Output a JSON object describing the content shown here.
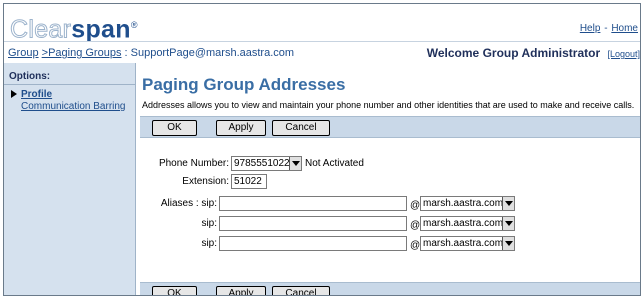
{
  "brand": {
    "part1": "Clear",
    "part2": "span",
    "tm": "®"
  },
  "toplinks": {
    "help": "Help",
    "sep": "-",
    "home": "Home"
  },
  "breadcrumb": {
    "group": "Group",
    "paging_groups": ">Paging Groups",
    "current": ": SupportPage@marsh.aastra.com"
  },
  "welcome": {
    "text": "Welcome Group Administrator",
    "logout": "[Logout]"
  },
  "sidebar": {
    "options_label": "Options:",
    "items": [
      {
        "label": "Profile",
        "active": true
      },
      {
        "label": "Communication Barring",
        "active": false
      }
    ]
  },
  "page": {
    "title": "Paging Group Addresses",
    "description": "Addresses allows you to view and maintain your phone number and other identities that are used to make and receive calls."
  },
  "buttons": {
    "ok": "OK",
    "apply": "Apply",
    "cancel": "Cancel"
  },
  "form": {
    "phone_number_label": "Phone Number:",
    "phone_number_value": "9785551022",
    "phone_status": "Not Activated",
    "extension_label": "Extension:",
    "extension_value": "51022",
    "aliases_label": "Aliases : sip:",
    "sip_label": "sip:",
    "at_symbol": "@",
    "aliases": [
      {
        "user": "",
        "domain": "marsh.aastra.com"
      },
      {
        "user": "",
        "domain": "marsh.aastra.com"
      },
      {
        "user": "",
        "domain": "marsh.aastra.com"
      }
    ]
  }
}
